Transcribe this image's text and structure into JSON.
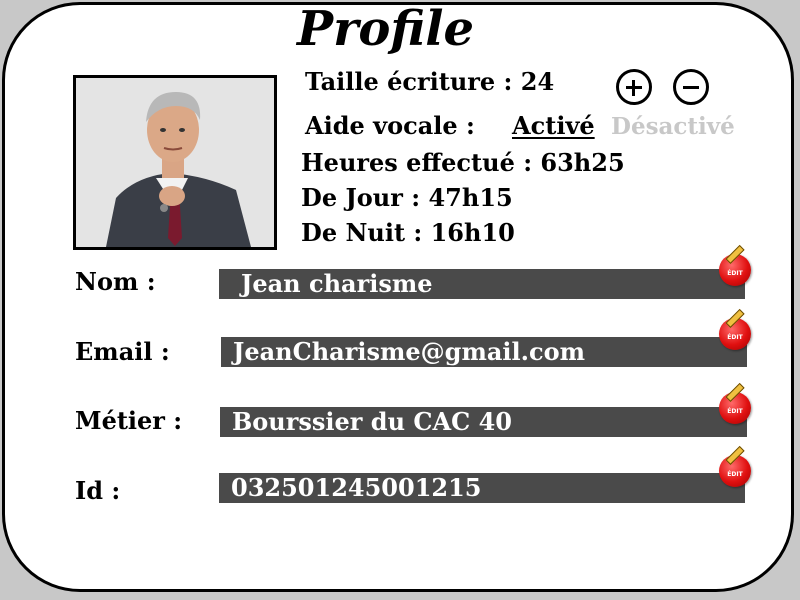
{
  "profile": {
    "title": "Profile",
    "font_size": {
      "label": "Taille écriture : 24"
    },
    "voice_aid": {
      "label": "Aide vocale :",
      "active_label": "Activé",
      "inactive_label": "Désactivé"
    },
    "hours": {
      "total": "Heures effectué : 63h25",
      "day": "De Jour : 47h15",
      "night": "De Nuit : 16h10"
    },
    "fields": [
      {
        "label": "Nom :",
        "value": "Jean charisme",
        "edit": "ÉDIT"
      },
      {
        "label": "Email :",
        "value": "JeanCharisme@gmail.com",
        "edit": "ÉDIT"
      },
      {
        "label": "Métier :",
        "value": "Bourssier du CAC 40",
        "edit": "ÉDIT"
      },
      {
        "label": "Id :",
        "value": "032501245001215",
        "edit": "ÉDIT"
      }
    ]
  },
  "colors": {
    "background": "#c8c8c8",
    "card": "#ffffff",
    "field_bg": "#4a4a4a",
    "edit_red": "#e01010",
    "inactive_text": "#c8c8c8"
  }
}
